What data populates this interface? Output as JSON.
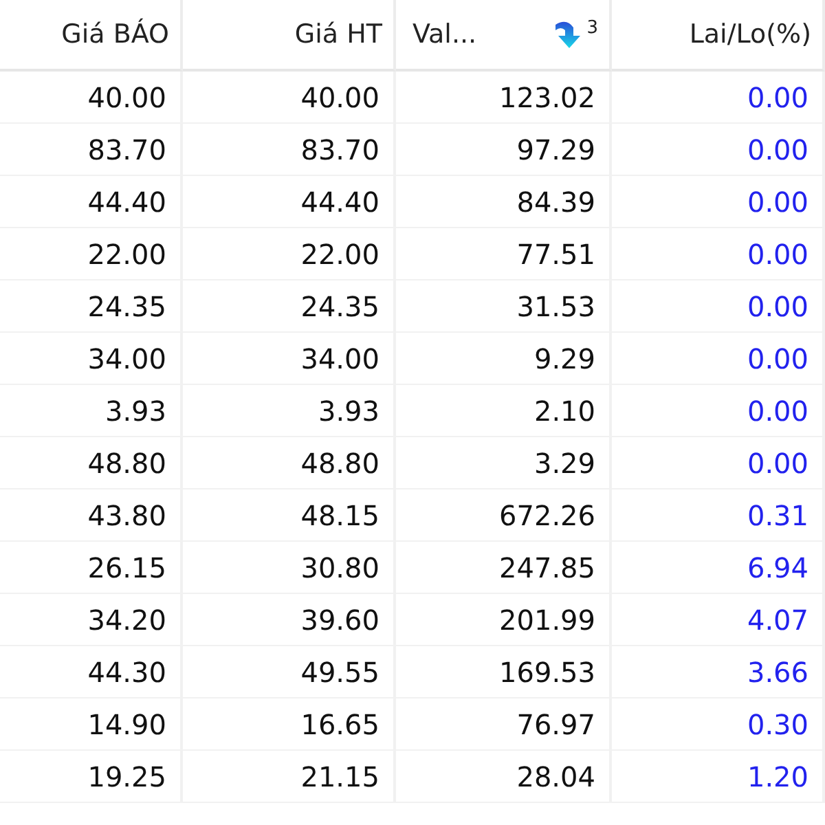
{
  "table": {
    "columns": [
      {
        "label": "Giá BÁO"
      },
      {
        "label": "Giá HT"
      },
      {
        "label": "Val...",
        "sort_order": "3"
      },
      {
        "label": "Lai/Lo(%)"
      }
    ],
    "rows": [
      [
        "40.00",
        "40.00",
        "123.02",
        "0.00"
      ],
      [
        "83.70",
        "83.70",
        "97.29",
        "0.00"
      ],
      [
        "44.40",
        "44.40",
        "84.39",
        "0.00"
      ],
      [
        "22.00",
        "22.00",
        "77.51",
        "0.00"
      ],
      [
        "24.35",
        "24.35",
        "31.53",
        "0.00"
      ],
      [
        "34.00",
        "34.00",
        "9.29",
        "0.00"
      ],
      [
        "3.93",
        "3.93",
        "2.10",
        "0.00"
      ],
      [
        "48.80",
        "48.80",
        "3.29",
        "0.00"
      ],
      [
        "43.80",
        "48.15",
        "672.26",
        "0.31"
      ],
      [
        "26.15",
        "30.80",
        "247.85",
        "6.94"
      ],
      [
        "34.20",
        "39.60",
        "201.99",
        "4.07"
      ],
      [
        "44.30",
        "49.55",
        "169.53",
        "3.66"
      ],
      [
        "14.90",
        "16.65",
        "76.97",
        "0.30"
      ],
      [
        "19.25",
        "21.15",
        "28.04",
        "1.20"
      ]
    ]
  }
}
